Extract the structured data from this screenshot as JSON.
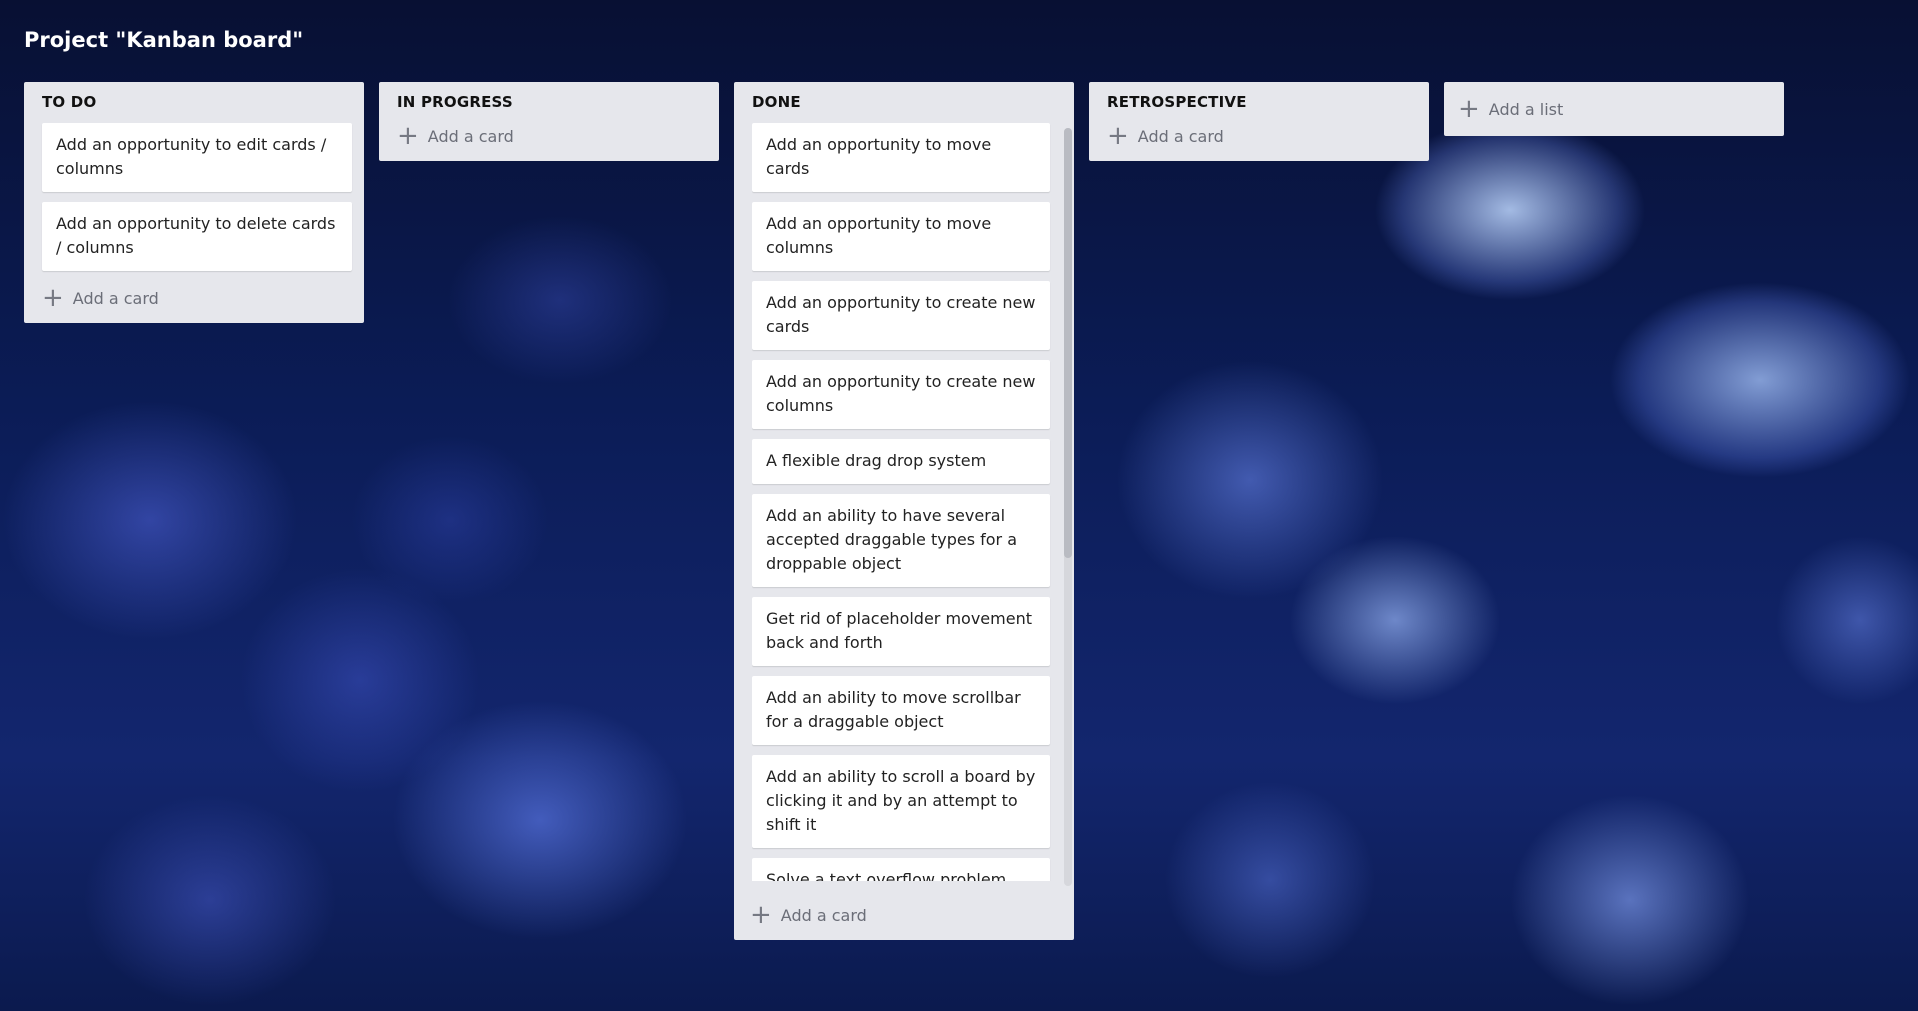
{
  "board": {
    "title": "Project \"Kanban board\""
  },
  "lists": [
    {
      "title": "TO DO",
      "cards": [
        "Add an opportunity to edit cards / columns",
        "Add an opportunity to delete cards / columns"
      ],
      "add_card_label": "Add a card"
    },
    {
      "title": "IN PROGRESS",
      "cards": [],
      "add_card_label": "Add a card"
    },
    {
      "title": "DONE",
      "cards": [
        "Add an opportunity to move cards",
        "Add an opportunity to move columns",
        "Add an opportunity to create new cards",
        "Add an opportunity to create new columns",
        "A flexible drag drop system",
        "Add an ability to have several accepted draggable types for a droppable object",
        "Get rid of placeholder movement back and forth",
        "Add an ability to move scrollbar for a draggable object",
        "Add an ability to scroll a board by clicking it and by an attempt to shift it",
        "Solve a text overflow problem",
        ""
      ],
      "add_card_label": "Add a card"
    },
    {
      "title": "RETROSPECTIVE",
      "cards": [],
      "add_card_label": "Add a card"
    }
  ],
  "add_list_label": "Add a list"
}
